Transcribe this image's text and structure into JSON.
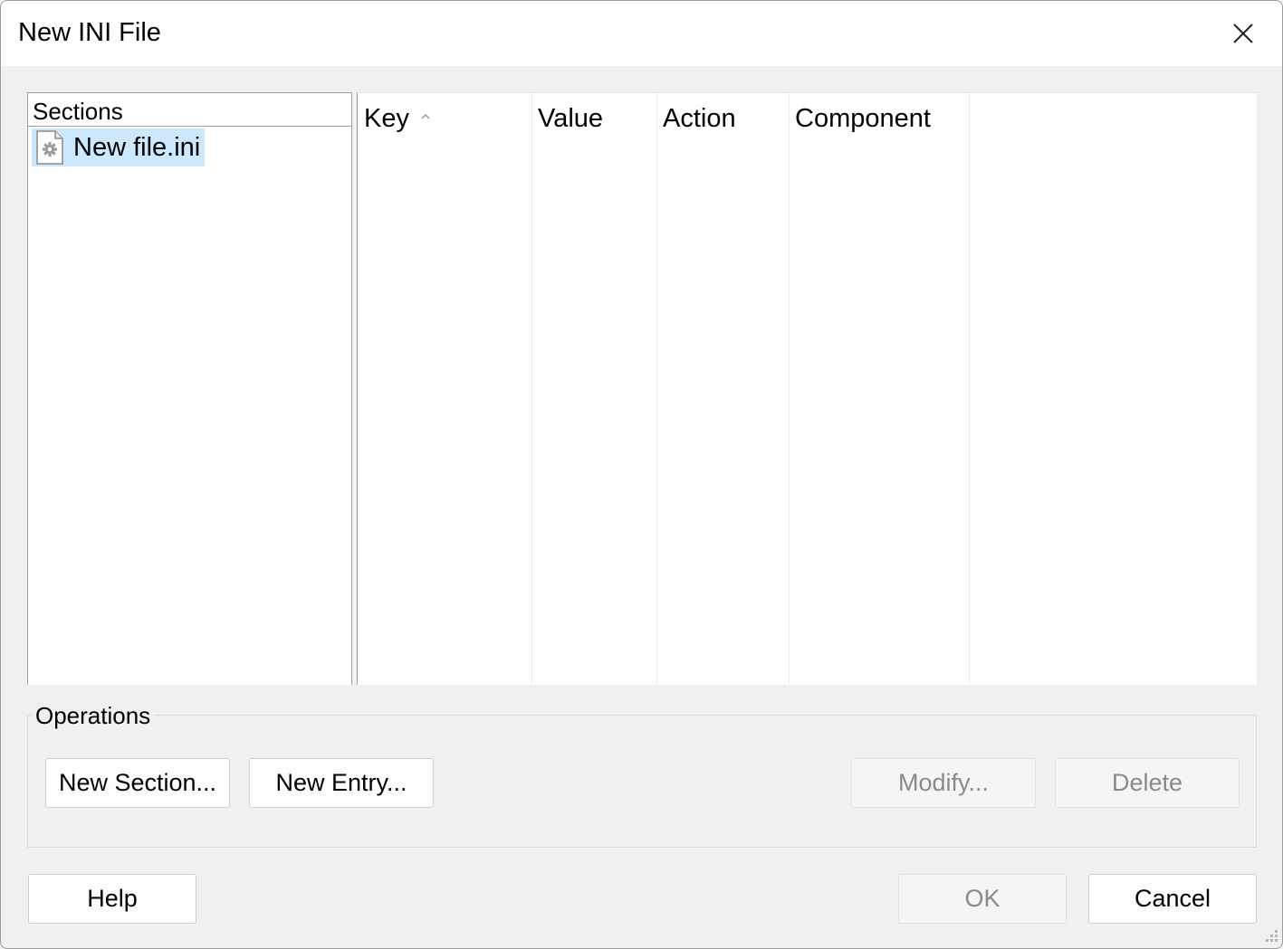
{
  "window": {
    "title": "New INI File"
  },
  "sections": {
    "header": "Sections",
    "items": [
      {
        "label": "New file.ini",
        "icon": "ini-file-icon",
        "selected": true
      }
    ]
  },
  "entries_table": {
    "columns": [
      {
        "label": "Key",
        "sort": "ascending"
      },
      {
        "label": "Value"
      },
      {
        "label": "Action"
      },
      {
        "label": "Component"
      }
    ],
    "rows": []
  },
  "operations": {
    "label": "Operations",
    "new_section": "New Section...",
    "new_entry": "New Entry...",
    "modify": "Modify...",
    "delete": "Delete"
  },
  "footer": {
    "help": "Help",
    "ok": "OK",
    "cancel": "Cancel"
  },
  "colors": {
    "selection": "#cce8ff",
    "dialog_bg": "#f0f0f0",
    "disabled_text": "#8a8a8a"
  }
}
